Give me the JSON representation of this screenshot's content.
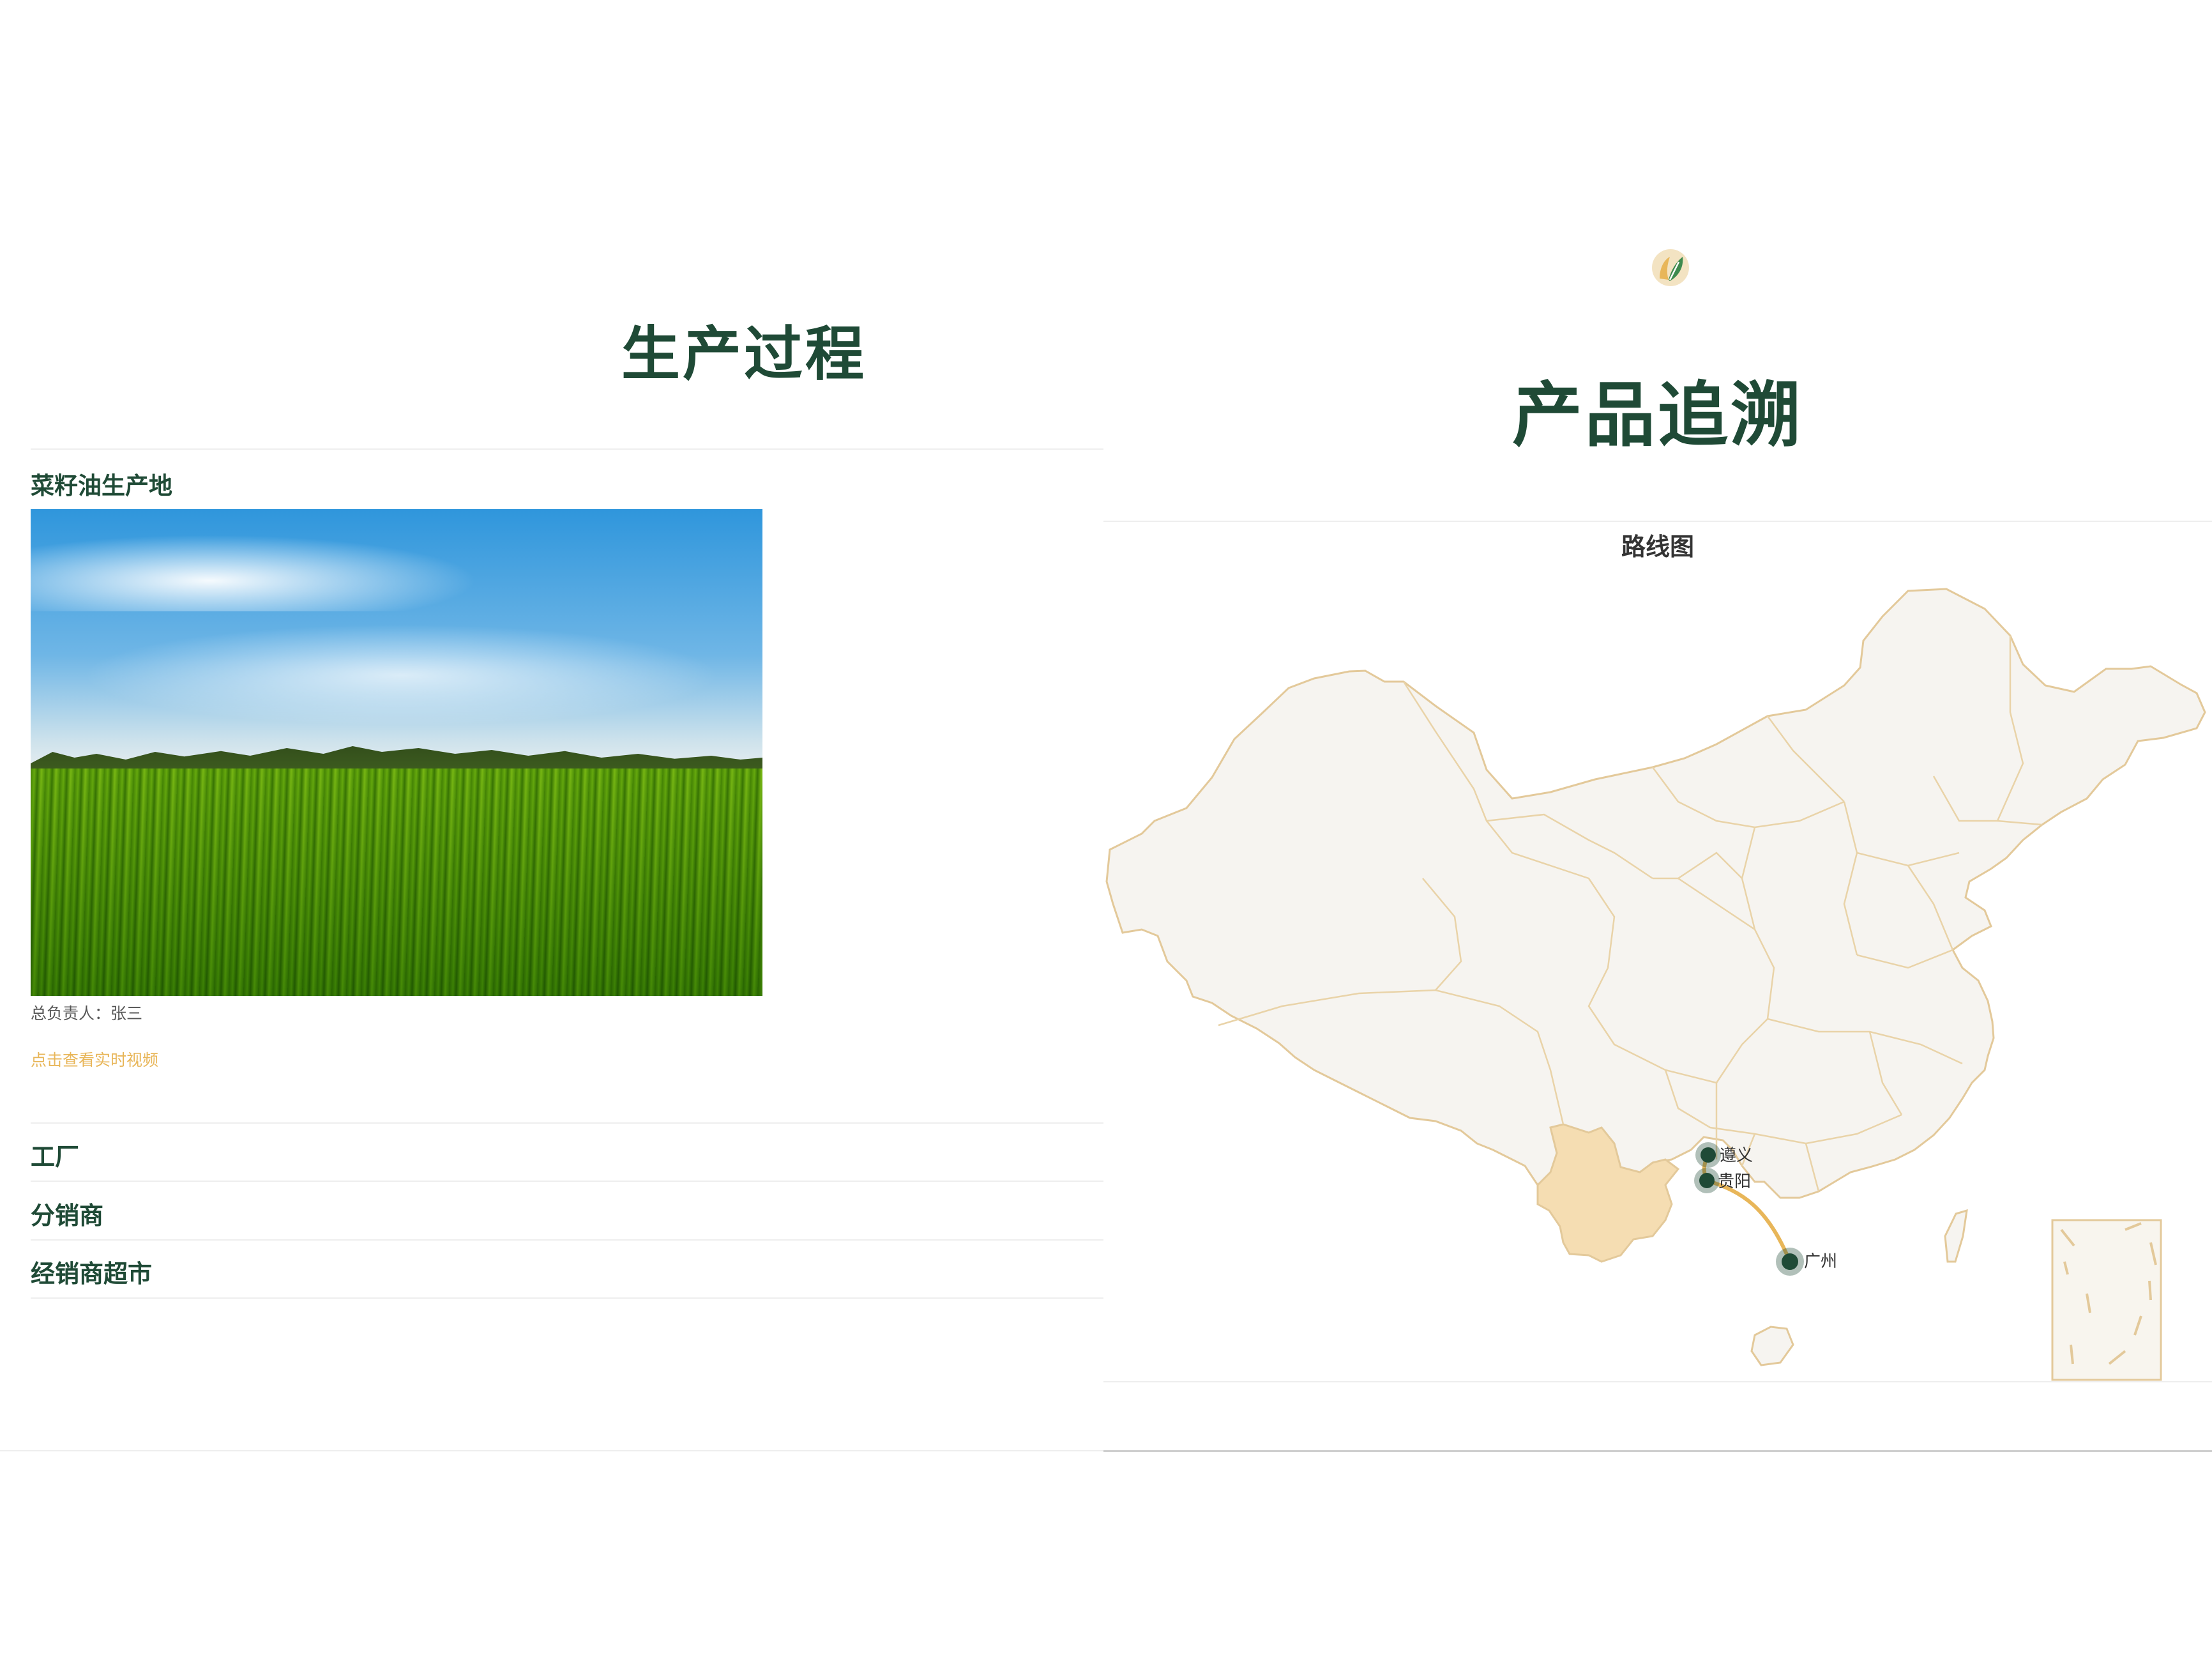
{
  "production": {
    "title": "生产过程",
    "origin_title": "菜籽油生产地",
    "responsible": "总负责人：张三",
    "video_link": "点击查看实时视频",
    "sections": [
      "工厂",
      "分销商",
      "经销商超市"
    ]
  },
  "trace": {
    "title": "产品追溯",
    "map_title": "路线图",
    "cities": [
      "遵义",
      "贵阳",
      "广州"
    ],
    "highlight_region": "yunnan",
    "colors": {
      "route": "#e8b659",
      "highlight": "#f5ddb2",
      "land": "#f6f4f0",
      "border": "#e3c99a",
      "marker": "#1f4a36"
    }
  }
}
